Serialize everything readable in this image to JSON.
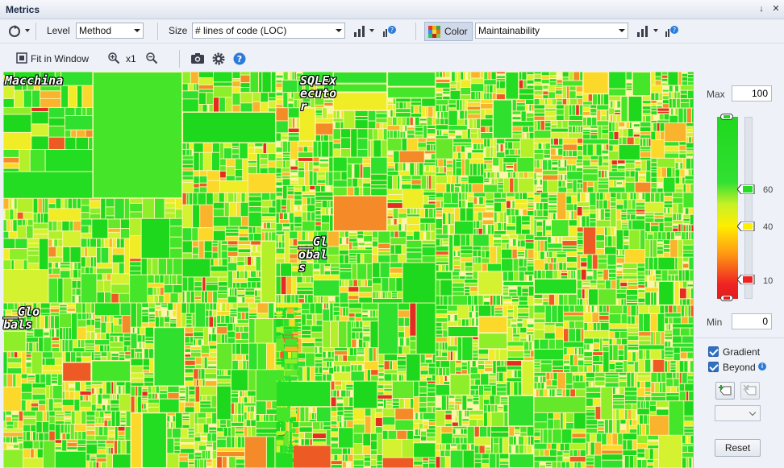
{
  "window": {
    "title": "Metrics",
    "pin_glyph": "↓",
    "close_glyph": "✕"
  },
  "toolbar": {
    "level_label": "Level",
    "level_value": "Method",
    "size_label": "Size",
    "size_value": "# lines of code (LOC)",
    "color_label": "Color",
    "color_value": "Maintainability",
    "fit_label": "Fit in Window",
    "zoom_label": "x1"
  },
  "treemap_labels": {
    "macchina": "Macchina",
    "sqlexecutor": "SQLEx\necuto\nr",
    "globals_mid": "__Gl\nobal\ns",
    "globals_left": "__Glo\nbals"
  },
  "legend": {
    "max_label": "Max",
    "max_value": "100",
    "min_label": "Min",
    "min_value": "0",
    "marker_high": "60",
    "marker_mid": "40",
    "marker_low": "10",
    "colors": {
      "high": "#22dd22",
      "mid": "#ffee00",
      "low": "#ee2222"
    }
  },
  "options": {
    "gradient_label": "Gradient",
    "gradient_checked": true,
    "beyond_label": "Beyond",
    "beyond_checked": true,
    "reset_label": "Reset"
  },
  "icons": [
    "refresh-icon",
    "bar-chart-icon",
    "help-icon",
    "fit-window-icon",
    "zoom-in-icon",
    "zoom-out-icon",
    "camera-icon",
    "gear-icon",
    "info-icon",
    "add-marker-icon",
    "remove-marker-icon"
  ]
}
